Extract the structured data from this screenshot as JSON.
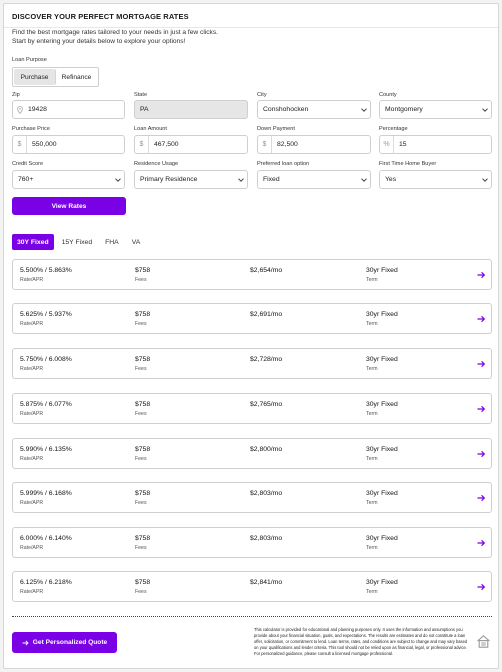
{
  "header": {
    "title": "DISCOVER YOUR PERFECT MORTGAGE RATES",
    "subtitle_line1": "Find the best mortgage rates tailored to your needs in just a few clicks.",
    "subtitle_line2": "Start by entering your details below to explore your options!"
  },
  "loan_purpose": {
    "label": "Loan Purpose",
    "options": [
      "Purchase",
      "Refinance"
    ],
    "selected": "Purchase"
  },
  "form": {
    "zip": {
      "label": "Zip",
      "value": "19428",
      "icon": "location-pin-icon"
    },
    "state": {
      "label": "State",
      "value": "PA"
    },
    "city": {
      "label": "City",
      "value": "Conshohocken"
    },
    "county": {
      "label": "County",
      "value": "Montgomery"
    },
    "purchase_price": {
      "label": "Purchase Price",
      "prefix": "$",
      "value": "550,000"
    },
    "loan_amount": {
      "label": "Loan Amount",
      "prefix": "$",
      "value": "467,500"
    },
    "down_payment": {
      "label": "Down Payment",
      "prefix": "$",
      "value": "82,500"
    },
    "percentage": {
      "label": "Percentage",
      "prefix": "%",
      "value": "15"
    },
    "credit_score": {
      "label": "Credit Score",
      "value": "760+"
    },
    "residence_usage": {
      "label": "Residence Usage",
      "value": "Primary Residence"
    },
    "preferred_loan_option": {
      "label": "Preferred loan option",
      "value": "Fixed"
    },
    "first_time_buyer": {
      "label": "First Time Home Buyer",
      "value": "Yes"
    }
  },
  "view_rates_label": "View Rates",
  "tabs": [
    {
      "label": "30Y Fixed",
      "active": true
    },
    {
      "label": "15Y Fixed",
      "active": false
    },
    {
      "label": "FHA",
      "active": false
    },
    {
      "label": "VA",
      "active": false
    }
  ],
  "rate_labels": {
    "rate_apr": "Rate/APR",
    "fees": "Fees",
    "term": "Term"
  },
  "rates": [
    {
      "rate": "5.500% / 5.863%",
      "fees": "$758",
      "payment": "$2,654/mo",
      "term": "30yr Fixed"
    },
    {
      "rate": "5.625% / 5.937%",
      "fees": "$758",
      "payment": "$2,691/mo",
      "term": "30yr Fixed"
    },
    {
      "rate": "5.750% / 6.008%",
      "fees": "$758",
      "payment": "$2,728/mo",
      "term": "30yr Fixed"
    },
    {
      "rate": "5.875% / 6.077%",
      "fees": "$758",
      "payment": "$2,765/mo",
      "term": "30yr Fixed"
    },
    {
      "rate": "5.990% / 6.135%",
      "fees": "$758",
      "payment": "$2,800/mo",
      "term": "30yr Fixed"
    },
    {
      "rate": "5.999% / 6.168%",
      "fees": "$758",
      "payment": "$2,803/mo",
      "term": "30yr Fixed"
    },
    {
      "rate": "6.000% / 6.140%",
      "fees": "$758",
      "payment": "$2,803/mo",
      "term": "30yr Fixed"
    },
    {
      "rate": "6.125% / 6.218%",
      "fees": "$758",
      "payment": "$2,841/mo",
      "term": "30yr Fixed"
    }
  ],
  "cta_label": "Get Personalized Quote",
  "disclaimer": "This calculator is provided for educational and planning purposes only. It uses the information and assumptions you provide about your financial situation, goals, and expectations. The results are estimates and do not constitute a loan offer, solicitation, or commitment to lend. Loan terms, rates, and conditions are subject to change and may vary based on your qualifications and lender criteria. This tool should not be relied upon as financial, legal, or professional advice. For personalized guidance, please consult a licensed mortgage professional.",
  "colors": {
    "accent": "#7a00e6",
    "border": "#cfcfcf",
    "disabled_bg": "#e6e6e6"
  }
}
